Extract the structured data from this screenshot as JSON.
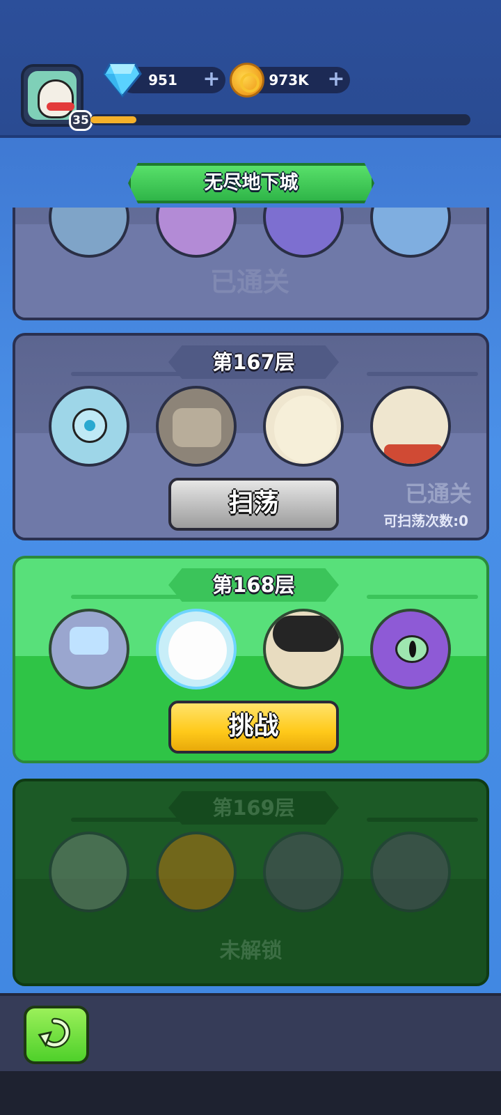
{
  "header": {
    "level": "35",
    "xp_fraction": 0.12,
    "gems": "951",
    "gold": "973K",
    "plus_symbol": "+",
    "icons": [
      "gem-icon",
      "gold-coin-icon",
      "plus-icon",
      "avatar"
    ]
  },
  "title": "无尽地下城",
  "floors": {
    "top_partial": {
      "status_text": "已通关"
    },
    "f167": {
      "label": "第167层",
      "button": "扫荡",
      "status_text": "已通关",
      "sweep_count": "可扫荡次数:0"
    },
    "f168": {
      "label": "第168层",
      "button": "挑战"
    },
    "f169": {
      "label": "第169层",
      "status_text": "未解锁"
    }
  },
  "footer": {
    "back_icon": "back-arrow-icon"
  },
  "colors": {
    "accent_green": "#3bc45a",
    "button_yellow": "#ffc91a",
    "cleared_gray": "#6a74a0",
    "locked_green": "#1c5a26"
  }
}
